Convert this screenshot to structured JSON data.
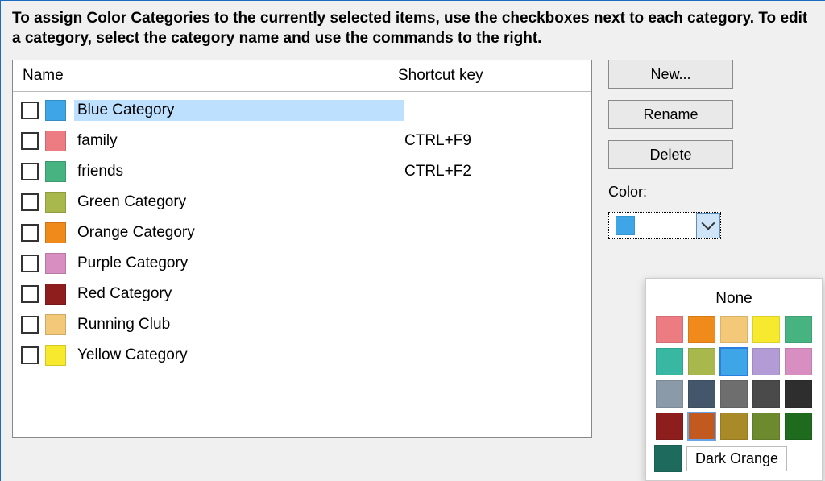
{
  "instructions": "To assign Color Categories to the currently selected items, use the checkboxes next to each category.  To edit a category, select the category name and use the commands to the right.",
  "columns": {
    "name": "Name",
    "shortcut": "Shortcut key"
  },
  "categories": [
    {
      "label": "Blue Category",
      "color": "#3ea6e6",
      "shortcut": "",
      "selected": true
    },
    {
      "label": "family",
      "color": "#ed7b82",
      "shortcut": "CTRL+F9",
      "selected": false
    },
    {
      "label": "friends",
      "color": "#47b381",
      "shortcut": "CTRL+F2",
      "selected": false
    },
    {
      "label": "Green Category",
      "color": "#a8b84c",
      "shortcut": "",
      "selected": false
    },
    {
      "label": "Orange Category",
      "color": "#f08a1a",
      "shortcut": "",
      "selected": false
    },
    {
      "label": "Purple Category",
      "color": "#d98ec2",
      "shortcut": "",
      "selected": false
    },
    {
      "label": "Red Category",
      "color": "#8e1e1e",
      "shortcut": "",
      "selected": false
    },
    {
      "label": "Running Club",
      "color": "#f3c878",
      "shortcut": "",
      "selected": false
    },
    {
      "label": "Yellow Category",
      "color": "#f7e92e",
      "shortcut": "",
      "selected": false
    }
  ],
  "buttons": {
    "new": "New...",
    "rename": "Rename",
    "delete": "Delete"
  },
  "color_section": {
    "label": "Color:",
    "current_color": "#3ea6e6"
  },
  "palette": {
    "none_label": "None",
    "tooltip": "Dark Orange",
    "rows": [
      [
        "#ed7b82",
        "#f08a1a",
        "#f3c878",
        "#f7e92e",
        "#47b381"
      ],
      [
        "#38b8a3",
        "#a8b84c",
        "#3ea6e6",
        "#b39cd6",
        "#d98ec2"
      ],
      [
        "#8a9aa8",
        "#44566b",
        "#6e6e6e",
        "#4a4a4a",
        "#2e2e2e"
      ],
      [
        "#8e1e1e",
        "#c25a1f",
        "#a88a28",
        "#6e8a2e",
        "#1e6b1e"
      ]
    ],
    "picked_index": [
      1,
      2
    ],
    "hover_index": [
      3,
      1
    ],
    "extra_cell_color": "#1e6b5e"
  }
}
